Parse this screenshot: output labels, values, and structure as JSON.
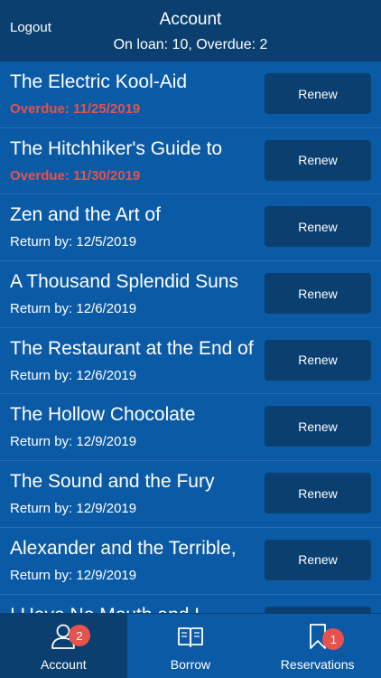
{
  "header": {
    "logout_label": "Logout",
    "title": "Account",
    "subtitle": "On loan: 10, Overdue: 2"
  },
  "colors": {
    "header_bg": "#0a3f70",
    "list_bg": "#0b5aa6",
    "overdue_text": "#e4534d",
    "badge_bg": "#e4534d"
  },
  "loans": [
    {
      "title": "The Electric Kool-Aid",
      "due": "Overdue: 11/25/2019",
      "overdue": true,
      "action": "Renew"
    },
    {
      "title": "The Hitchhiker's Guide to",
      "due": "Overdue: 11/30/2019",
      "overdue": true,
      "action": "Renew"
    },
    {
      "title": "Zen and the Art of",
      "due": "Return by: 12/5/2019",
      "overdue": false,
      "action": "Renew"
    },
    {
      "title": "A Thousand Splendid Suns",
      "due": "Return by: 12/6/2019",
      "overdue": false,
      "action": "Renew"
    },
    {
      "title": "The Restaurant at the End of",
      "due": "Return by: 12/6/2019",
      "overdue": false,
      "action": "Renew"
    },
    {
      "title": "The Hollow Chocolate",
      "due": "Return by: 12/9/2019",
      "overdue": false,
      "action": "Renew"
    },
    {
      "title": "The Sound and the Fury",
      "due": "Return by: 12/9/2019",
      "overdue": false,
      "action": "Renew"
    },
    {
      "title": "Alexander and the Terrible,",
      "due": "Return by: 12/9/2019",
      "overdue": false,
      "action": "Renew"
    },
    {
      "title": "I Have No Mouth and I",
      "due": "",
      "overdue": false,
      "action": ""
    }
  ],
  "tabs": [
    {
      "label": "Account",
      "icon": "user-icon",
      "badge": "2",
      "active": true
    },
    {
      "label": "Borrow",
      "icon": "book-icon",
      "badge": "",
      "active": false
    },
    {
      "label": "Reservations",
      "icon": "bookmark-icon",
      "badge": "1",
      "active": false
    }
  ]
}
